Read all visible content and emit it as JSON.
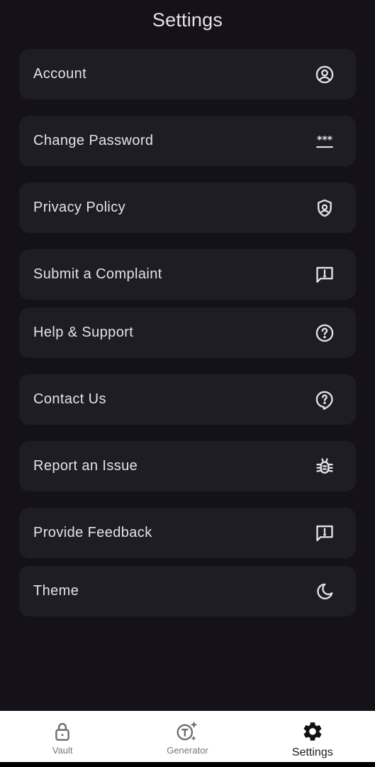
{
  "header": {
    "title": "Settings"
  },
  "settings": {
    "items": [
      {
        "label": "Account",
        "icon": "account-circle-icon"
      },
      {
        "label": "Change Password",
        "icon": "password-icon"
      },
      {
        "label": "Privacy Policy",
        "icon": "shield-icon"
      },
      {
        "label": "Submit a Complaint",
        "icon": "feedback-icon"
      },
      {
        "label": "Help & Support",
        "icon": "help-circle-icon"
      },
      {
        "label": "Contact Us",
        "icon": "contact-support-icon"
      },
      {
        "label": "Report an Issue",
        "icon": "bug-icon"
      },
      {
        "label": "Provide Feedback",
        "icon": "feedback-icon"
      },
      {
        "label": "Theme",
        "icon": "moon-icon"
      }
    ]
  },
  "bottom_nav": {
    "items": [
      {
        "label": "Vault",
        "icon": "lock-icon",
        "active": false
      },
      {
        "label": "Generator",
        "icon": "generator-icon",
        "active": false
      },
      {
        "label": "Settings",
        "icon": "gear-icon",
        "active": true
      }
    ]
  },
  "colors": {
    "background": "#141218",
    "card": "#1F1D24",
    "text": "#E6E0E9",
    "nav_background": "#FFFFFF"
  }
}
